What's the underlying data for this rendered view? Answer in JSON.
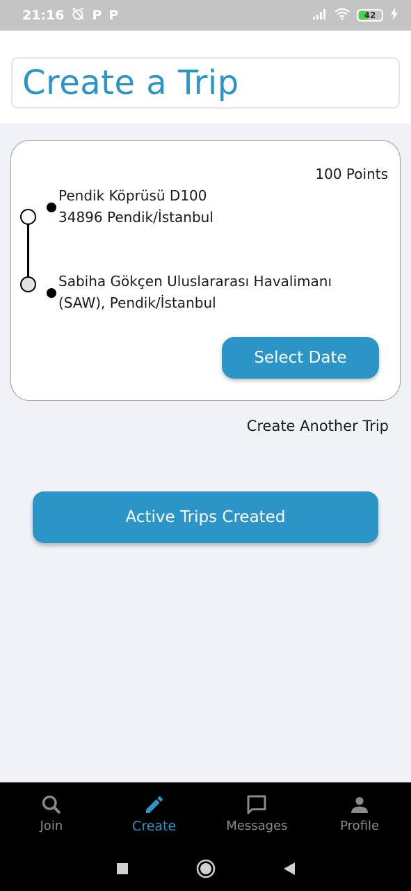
{
  "status_bar": {
    "time": "21:16",
    "alarm_icon": "alarm-off-icon",
    "notifications": [
      "P",
      "P"
    ],
    "battery_level": "42",
    "battery_fraction": 0.42
  },
  "header": {
    "title": "Create a Trip"
  },
  "trip_card": {
    "points": "100 Points",
    "origin_line1": "Pendik Köprüsü D100",
    "origin_line2": "34896 Pendik/İstanbul",
    "destination_line1": "Sabiha Gökçen Uluslararası Havalimanı",
    "destination_line2": "(SAW), Pendik/İstanbul",
    "select_date_label": "Select Date"
  },
  "create_another_label": "Create Another Trip",
  "active_trips_label": "Active Trips Created",
  "bottom_nav": {
    "items": [
      {
        "label": "Join",
        "icon": "search-icon"
      },
      {
        "label": "Create",
        "icon": "pencil-icon",
        "active": true
      },
      {
        "label": "Messages",
        "icon": "chat-icon"
      },
      {
        "label": "Profile",
        "icon": "person-icon"
      }
    ]
  },
  "colors": {
    "accent": "#2a95c6",
    "nav_inactive": "#8a8a8a"
  }
}
